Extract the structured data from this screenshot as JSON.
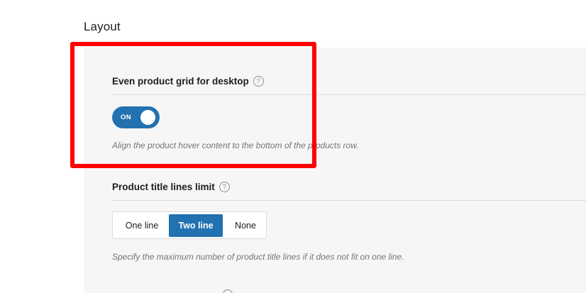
{
  "section": {
    "title": "Layout"
  },
  "fields": {
    "even_grid": {
      "title": "Even product grid for desktop",
      "help_icon": "question-mark-icon",
      "toggle_label": "ON",
      "toggle_state": "on",
      "description": "Align the product hover content to the bottom of the products row."
    },
    "title_lines": {
      "title": "Product title lines limit",
      "help_icon": "question-mark-icon",
      "options": [
        "One line",
        "Two line",
        "None"
      ],
      "selected": "Two line",
      "description": "Specify the maximum number of product title lines if it does not fit on one line."
    }
  },
  "colors": {
    "accent": "#2271b1",
    "highlight": "#fe0000",
    "panel_bg": "#f6f6f6",
    "muted_text": "#757575"
  }
}
